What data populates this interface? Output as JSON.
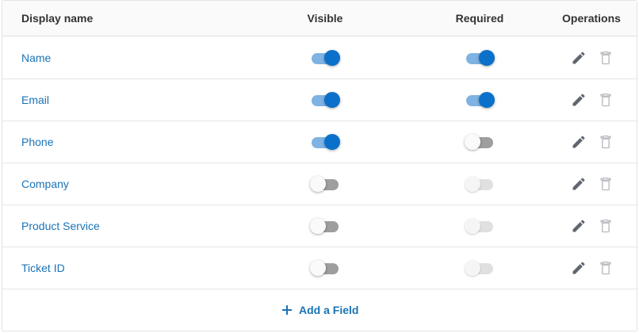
{
  "columns": {
    "display_name": "Display name",
    "visible": "Visible",
    "required": "Required",
    "operations": "Operations"
  },
  "rows": [
    {
      "name": "Name",
      "visible": true,
      "required": true,
      "required_enabled": true
    },
    {
      "name": "Email",
      "visible": true,
      "required": true,
      "required_enabled": true
    },
    {
      "name": "Phone",
      "visible": true,
      "required": false,
      "required_enabled": true
    },
    {
      "name": "Company",
      "visible": false,
      "required": false,
      "required_enabled": false
    },
    {
      "name": "Product Service",
      "visible": false,
      "required": false,
      "required_enabled": false
    },
    {
      "name": "Ticket ID",
      "visible": false,
      "required": false,
      "required_enabled": false
    }
  ],
  "operations": {
    "edit_icon": "pencil-icon",
    "delete_icon": "trash-icon"
  },
  "footer": {
    "add_field_label": "Add a Field",
    "add_icon": "plus-icon"
  },
  "colors": {
    "link": "#1a73b6",
    "toggle_on": "#0b70c9",
    "toggle_on_track": "#7eb3e3",
    "toggle_off_track": "#9e9e9e"
  }
}
